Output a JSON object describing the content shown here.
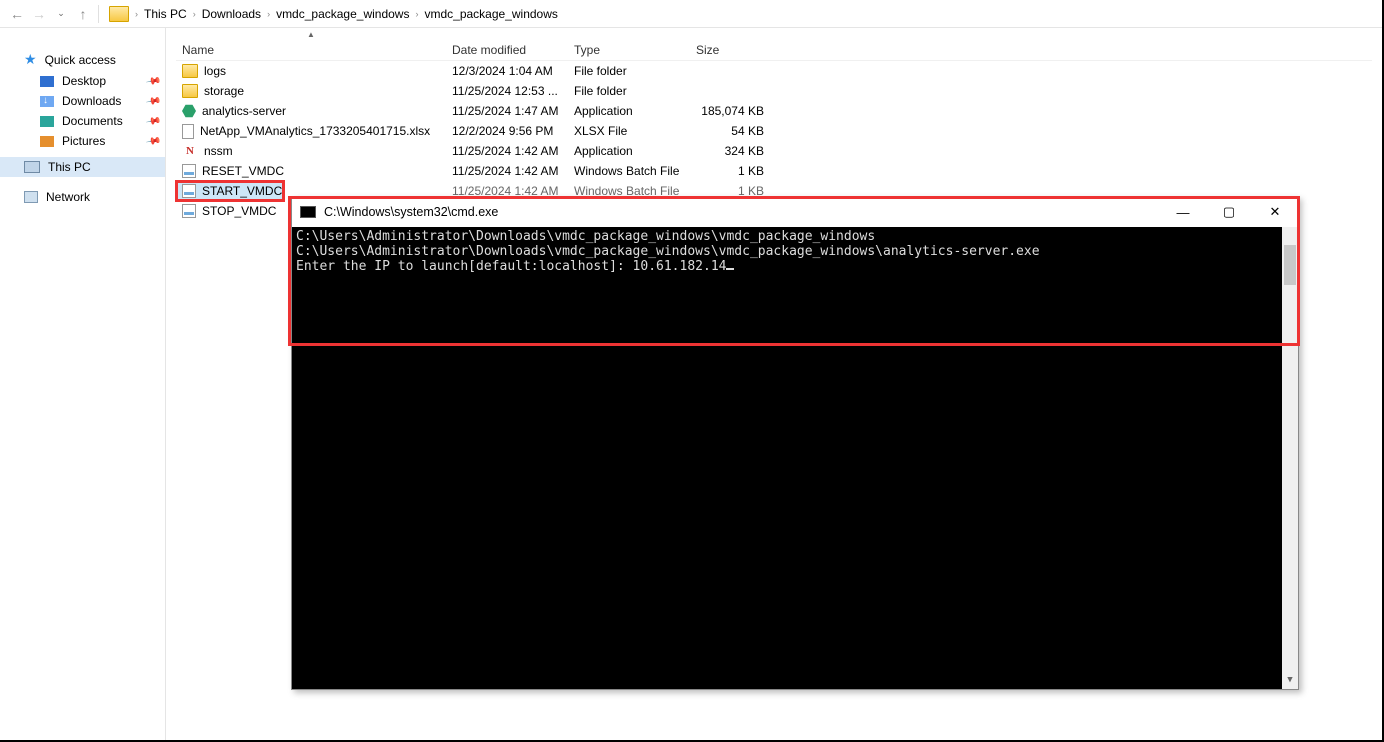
{
  "breadcrumb": {
    "segments": [
      "This PC",
      "Downloads",
      "vmdc_package_windows",
      "vmdc_package_windows"
    ]
  },
  "nav": {
    "quick_access": "Quick access",
    "desktop": "Desktop",
    "downloads": "Downloads",
    "documents": "Documents",
    "pictures": "Pictures",
    "this_pc": "This PC",
    "network": "Network"
  },
  "columns": {
    "name": "Name",
    "date": "Date modified",
    "type": "Type",
    "size": "Size"
  },
  "files": [
    {
      "name": "logs",
      "date": "12/3/2024 1:04 AM",
      "type": "File folder",
      "size": "",
      "icon": "folder"
    },
    {
      "name": "storage",
      "date": "11/25/2024 12:53 ...",
      "type": "File folder",
      "size": "",
      "icon": "folder"
    },
    {
      "name": "analytics-server",
      "date": "11/25/2024 1:47 AM",
      "type": "Application",
      "size": "185,074 KB",
      "icon": "hex"
    },
    {
      "name": "NetApp_VMAnalytics_1733205401715.xlsx",
      "date": "12/2/2024 9:56 PM",
      "type": "XLSX File",
      "size": "54 KB",
      "icon": "page"
    },
    {
      "name": "nssm",
      "date": "11/25/2024 1:42 AM",
      "type": "Application",
      "size": "324 KB",
      "icon": "nred"
    },
    {
      "name": "RESET_VMDC",
      "date": "11/25/2024 1:42 AM",
      "type": "Windows Batch File",
      "size": "1 KB",
      "icon": "bat"
    },
    {
      "name": "START_VMDC",
      "date": "11/25/2024 1:42 AM",
      "type": "Windows Batch File",
      "size": "1 KB",
      "icon": "bat"
    },
    {
      "name": "STOP_VMDC",
      "date": "",
      "type": "",
      "size": "",
      "icon": "bat"
    }
  ],
  "cmd": {
    "title": "C:\\Windows\\system32\\cmd.exe",
    "lines": [
      "C:\\Users\\Administrator\\Downloads\\vmdc_package_windows\\vmdc_package_windows",
      "C:\\Users\\Administrator\\Downloads\\vmdc_package_windows\\vmdc_package_windows\\analytics-server.exe",
      "Enter the IP to launch[default:localhost]: 10.61.182.14"
    ]
  }
}
